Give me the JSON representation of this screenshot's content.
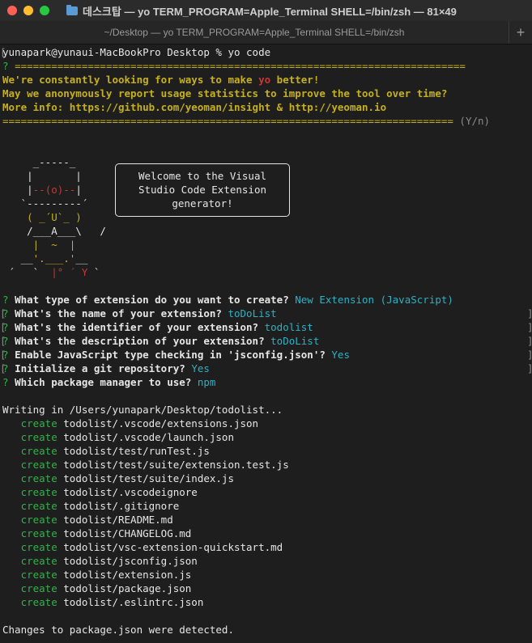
{
  "window": {
    "title": "데스크탑 — yo TERM_PROGRAM=Apple_Terminal SHELL=/bin/zsh — 81×49",
    "tab_title": "~/Desktop — yo TERM_PROGRAM=Apple_Terminal SHELL=/bin/zsh",
    "new_tab": "+",
    "colors": {
      "close": "#fe5f57",
      "minimize": "#febc2e",
      "zoom": "#28c840",
      "folder": "#5b9bd5"
    }
  },
  "prompt": "yunapark@yunaui-MacBookPro Desktop % yo code",
  "insight": {
    "q": "? ",
    "sep": "==========================================================================",
    "line1a": "We're constantly looking for ways to make ",
    "line1b": "yo",
    "line1c": " better!",
    "line2": "May we anonymously report usage statistics to improve the tool over time?",
    "line3": "More info: https://github.com/yeoman/insight & http://yeoman.io",
    "sep2": "==========================================================================",
    "yn": " (Y/n)"
  },
  "yeoman": {
    "art": [
      "     _-----_     ",
      "    |       |    ",
      "    |--(o)--|    ",
      "   `---------´   ",
      "    ( _´U`_ )    ",
      "    /___A___\\   /",
      "     |  ~  |     ",
      "   __'.___.'__   ",
      " ´   `  |° ´ Y ` "
    ],
    "welcome": [
      "Welcome to the Visual",
      "Studio Code Extension",
      "generator!"
    ]
  },
  "questions": [
    {
      "mark": "?",
      "q": "What type of extension do you want to create?",
      "a": "New Extension (JavaScript)"
    },
    {
      "mark": "?",
      "q": "What's the name of your extension?",
      "a": "toDoList"
    },
    {
      "mark": "?",
      "q": "What's the identifier of your extension?",
      "a": "todolist"
    },
    {
      "mark": "?",
      "q": "What's the description of your extension?",
      "a": "toDoList"
    },
    {
      "mark": "?",
      "q": "Enable JavaScript type checking in 'jsconfig.json'?",
      "a": "Yes"
    },
    {
      "mark": "?",
      "q": "Initialize a git repository?",
      "a": "Yes"
    },
    {
      "mark": "?",
      "q": "Which package manager to use?",
      "a": "npm"
    }
  ],
  "writing": "Writing in /Users/yunapark/Desktop/todolist...",
  "create_label": "create",
  "files": [
    "todolist/.vscode/extensions.json",
    "todolist/.vscode/launch.json",
    "todolist/test/runTest.js",
    "todolist/test/suite/extension.test.js",
    "todolist/test/suite/index.js",
    "todolist/.vscodeignore",
    "todolist/.gitignore",
    "todolist/README.md",
    "todolist/CHANGELOG.md",
    "todolist/vsc-extension-quickstart.md",
    "todolist/jsconfig.json",
    "todolist/extension.js",
    "todolist/package.json",
    "todolist/.eslintrc.json"
  ],
  "changes": "Changes to package.json were detected."
}
